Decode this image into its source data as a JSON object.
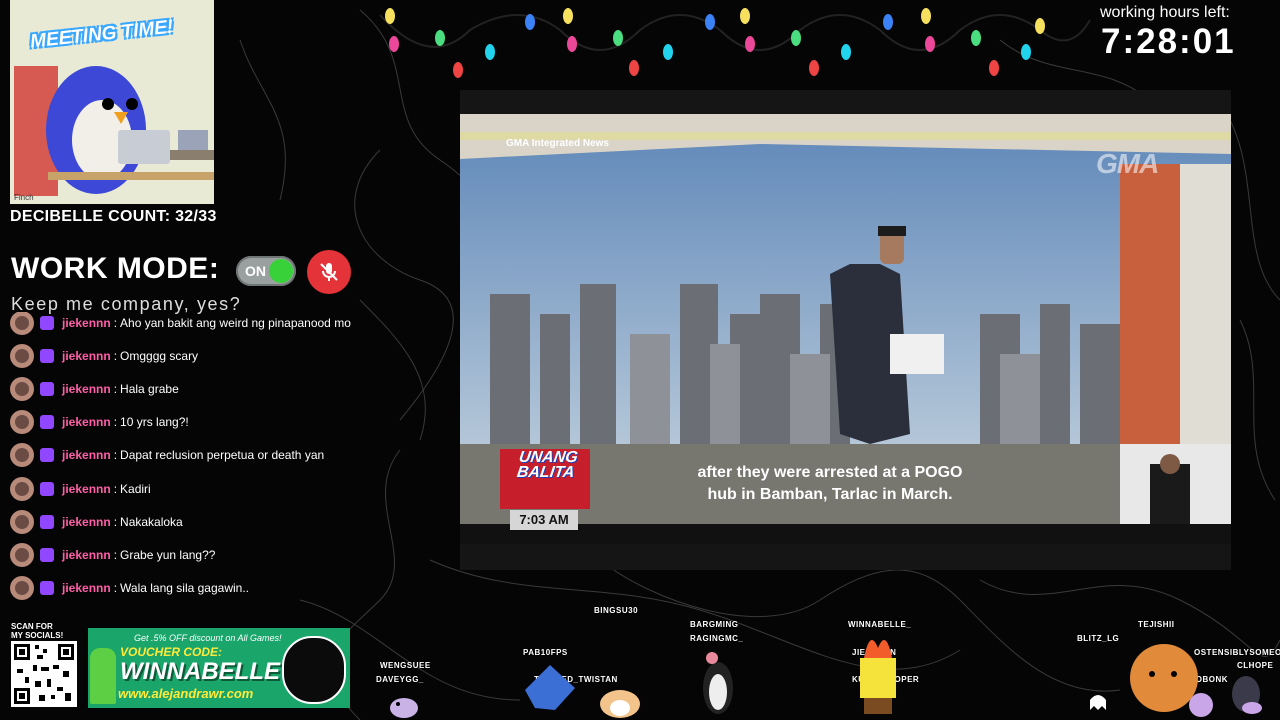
{
  "meeting": {
    "title": "MEETING TIME!",
    "caption": "Finch"
  },
  "decibelle": "DECIBELLE COUNT: 32/33",
  "work_mode": {
    "label": "WORK MODE:",
    "toggle": "ON",
    "subtitle": "Keep me company, yes?"
  },
  "timer": {
    "label": "working hours left:",
    "value": "7:28:01"
  },
  "chat": [
    {
      "user": "jiekennn",
      "msg": "Aho yan bakit ang weird ng pinapanood mo"
    },
    {
      "user": "jiekennn",
      "msg": "Omgggg scary"
    },
    {
      "user": "jiekennn",
      "msg": "Hala grabe"
    },
    {
      "user": "jiekennn",
      "msg": "10 yrs lang?!"
    },
    {
      "user": "jiekennn",
      "msg": "Dapat reclusion perpetua or death yan"
    },
    {
      "user": "jiekennn",
      "msg": "Kadiri"
    },
    {
      "user": "jiekennn",
      "msg": "Nakakaloka"
    },
    {
      "user": "jiekennn",
      "msg": "Grabe yun lang??"
    },
    {
      "user": "jiekennn",
      "msg": "Wala lang sila gagawin.."
    }
  ],
  "video": {
    "source": "GMA Integrated News",
    "logo": "GMA",
    "caption_line1": "after they were arrested at a POGO",
    "caption_line2": "hub in Bamban, Tarlac in March.",
    "show_line1": "UNANG",
    "show_line2": "BALITA",
    "time": "7:03 AM"
  },
  "socials": {
    "scan_line1": "SCAN FOR",
    "scan_line2": "MY SOCIALS!"
  },
  "voucher": {
    "discount": "Get .5% OFF discount on All Games!",
    "code_label": "VOUCHER CODE:",
    "code": "WINNABELLE",
    "url": "www.alejandrawr.com"
  },
  "viewers": {
    "bingsu": "BINGSU30",
    "wengsuee": "WENGSUEE",
    "daveygg": "DAVEYGG_",
    "pab": "PAB10FPS",
    "twisted": "TWISTED_TWISTAN",
    "bargming": "BARGMING",
    "raging": "RAGINGMC_",
    "winnabelle": "WINNABELLE_",
    "jiekenn": "JIEKENNN",
    "kurix": "KURIX-TOOPER",
    "blitz": "BLITZ_LG",
    "tejishii": "TEJISHII",
    "ostensibly": "OSTENSIBLYSOMEO",
    "clhope": "CLHOPE",
    "henlobonk": "HENLOBONK"
  },
  "colors": {
    "username": "#ff5fa8",
    "mic_off": "#e5333a",
    "toggle_on": "#39d13a",
    "twitch": "#9146ff",
    "voucher_bg": "#1aa56b"
  }
}
